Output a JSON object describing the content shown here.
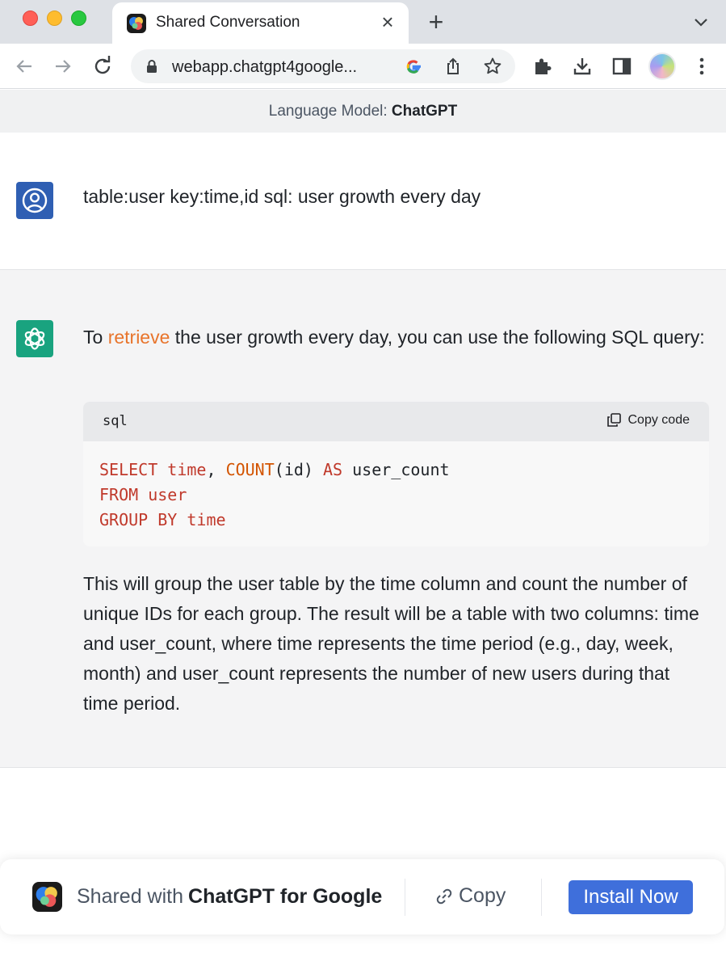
{
  "browser": {
    "tab_title": "Shared Conversation",
    "url": "webapp.chatgpt4google...",
    "icons": [
      "back-icon",
      "forward-icon",
      "reload-icon",
      "lock-icon",
      "google-icon",
      "share-icon",
      "star-icon",
      "extensions-icon",
      "download-icon",
      "sidepanel-icon",
      "profile-avatar",
      "more-icon"
    ]
  },
  "model_bar": {
    "label": "Language Model:",
    "value": "ChatGPT"
  },
  "user_message": {
    "text": "table:user key:time,id sql: user growth every day"
  },
  "assistant_message": {
    "intro_before": "To ",
    "intro_highlight": "retrieve",
    "intro_after": " the user growth every day, you can use the following SQL query:",
    "code_block": {
      "language": "sql",
      "copy_label": "Copy code",
      "tokens": {
        "select": "SELECT",
        "time1": " time",
        "comma": ", ",
        "count": "COUNT",
        "paren": "(id) ",
        "as": "AS",
        "alias": " user_count",
        "from": "FROM",
        "user": " user",
        "groupby": "GROUP BY",
        "time2": " time"
      }
    },
    "explanation": "This will group the user table by the time column and count the number of unique IDs for each group. The result will be a table with two columns: time and user_count, where time represents the time period (e.g., day, week, month) and user_count represents the number of new users during that time period."
  },
  "share_bar": {
    "shared_with": "Shared with",
    "product": "ChatGPT for Google",
    "copy_label": "Copy",
    "install_label": "Install Now"
  },
  "colors": {
    "install_button": "#3f6fdb",
    "user_avatar": "#2f5fb3",
    "bot_avatar": "#19a37f",
    "highlight": "#e8742b",
    "sql_keyword": "#c0392b"
  }
}
